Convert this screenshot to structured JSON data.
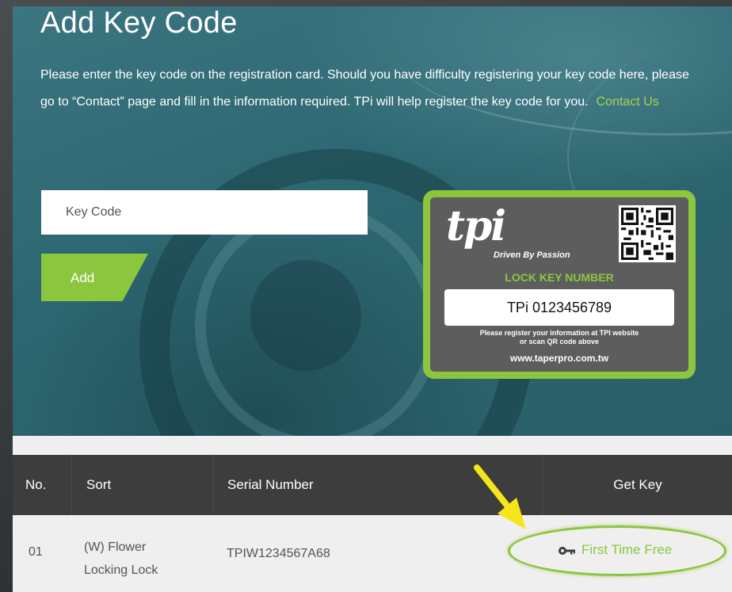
{
  "hero": {
    "title": "Add Key Code",
    "intro": "Please enter the key code on the registration card. Should you have difficulty registering your key code here, please go to “Contact” page and fill in the information required. TPi will help register the key code for you.",
    "contact_link": "Contact Us",
    "input_placeholder": "Key Code",
    "add_button": "Add"
  },
  "card": {
    "logo_text": "tpi",
    "tagline": "Driven By Passion",
    "heading": "LOCK KEY NUMBER",
    "number": "TPi 0123456789",
    "note_line1": "Please register your information at TPI website",
    "note_line2": "or scan QR code above",
    "url": "www.taperpro.com.tw",
    "qr_icon": "qr-code-icon"
  },
  "table": {
    "headers": [
      "No.",
      "Sort",
      "Serial Number",
      "Get Key"
    ],
    "rows": [
      {
        "no": "01",
        "sort_line1": "(W) Flower",
        "sort_line2": "Locking Lock",
        "serial": "TPIW1234567A68",
        "action_icon": "key-icon",
        "action": "First Time Free"
      }
    ]
  },
  "colors": {
    "accent_green": "#8cc63f",
    "arrow_yellow": "#f5e61a",
    "header_bg": "#3d3d3d",
    "hero_teal": "#2c6670"
  }
}
